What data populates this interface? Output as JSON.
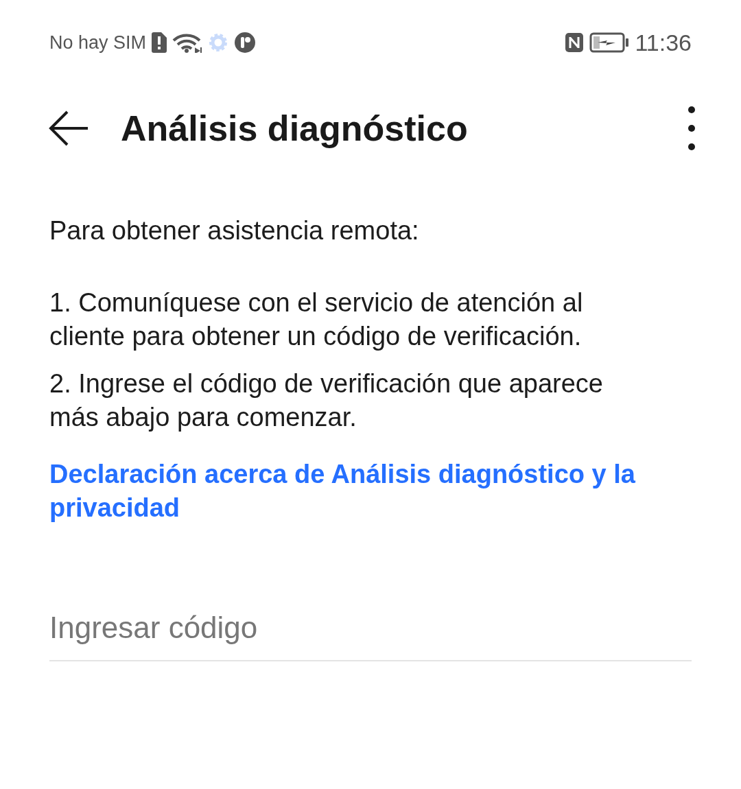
{
  "status_bar": {
    "carrier": "No hay SIM",
    "time": "11:36"
  },
  "app_bar": {
    "title": "Análisis diagnóstico"
  },
  "content": {
    "intro": "Para obtener asistencia remota:",
    "steps": [
      "1. Comuníquese con el servicio de atención al cliente para obtener un código de verificación.",
      "2. Ingrese el código de verificación que aparece más abajo para comenzar."
    ],
    "link": "Declaración acerca de Análisis diagnóstico y la privacidad"
  },
  "code_field": {
    "placeholder": "Ingresar código"
  }
}
